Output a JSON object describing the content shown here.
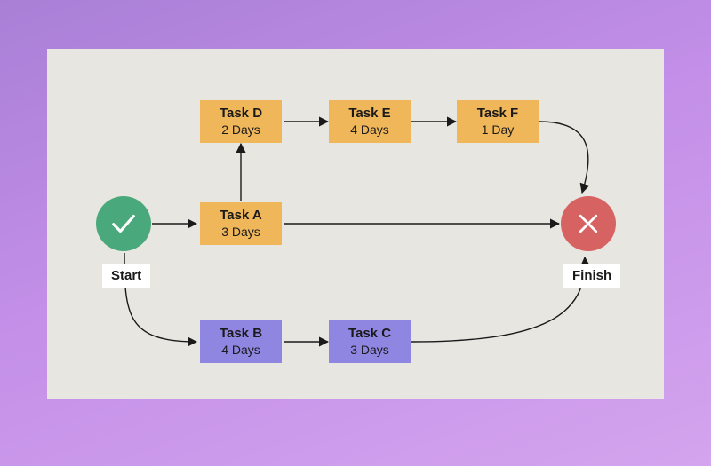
{
  "chart_data": {
    "type": "diagram",
    "title": "",
    "nodes": [
      {
        "id": "start",
        "kind": "terminal",
        "label": "Start",
        "icon": "check"
      },
      {
        "id": "finish",
        "kind": "terminal",
        "label": "Finish",
        "icon": "x"
      },
      {
        "id": "A",
        "kind": "task",
        "label": "Task A",
        "duration": "3 Days",
        "color": "orange"
      },
      {
        "id": "B",
        "kind": "task",
        "label": "Task B",
        "duration": "4 Days",
        "color": "purple"
      },
      {
        "id": "C",
        "kind": "task",
        "label": "Task C",
        "duration": "3 Days",
        "color": "purple"
      },
      {
        "id": "D",
        "kind": "task",
        "label": "Task D",
        "duration": "2 Days",
        "color": "orange"
      },
      {
        "id": "E",
        "kind": "task",
        "label": "Task E",
        "duration": "4 Days",
        "color": "orange"
      },
      {
        "id": "F",
        "kind": "task",
        "label": "Task F",
        "duration": "1 Day",
        "color": "orange"
      }
    ],
    "edges": [
      [
        "start",
        "A"
      ],
      [
        "start",
        "B"
      ],
      [
        "A",
        "D"
      ],
      [
        "A",
        "finish"
      ],
      [
        "B",
        "C"
      ],
      [
        "C",
        "finish"
      ],
      [
        "D",
        "E"
      ],
      [
        "E",
        "F"
      ],
      [
        "F",
        "finish"
      ]
    ]
  },
  "start": {
    "label": "Start"
  },
  "finish": {
    "label": "Finish"
  },
  "tasks": {
    "A": {
      "title": "Task A",
      "days": "3 Days"
    },
    "B": {
      "title": "Task B",
      "days": "4 Days"
    },
    "C": {
      "title": "Task C",
      "days": "3 Days"
    },
    "D": {
      "title": "Task D",
      "days": "2 Days"
    },
    "E": {
      "title": "Task E",
      "days": "4 Days"
    },
    "F": {
      "title": "Task F",
      "days": "1 Day"
    }
  }
}
